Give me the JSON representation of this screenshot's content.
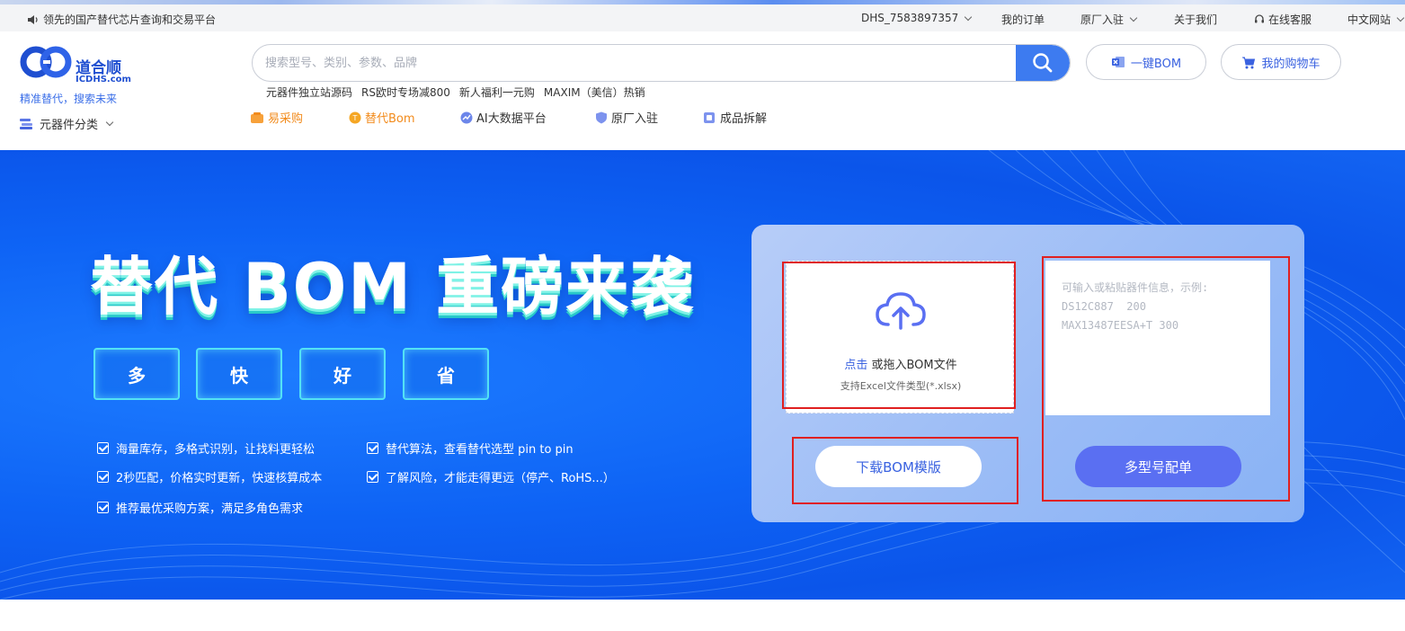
{
  "util_bar": {
    "notice": "领先的国产替代芯片查询和交易平台",
    "user": "DHS_7583897357",
    "orders": "我的订单",
    "factory": "原厂入驻",
    "about": "关于我们",
    "service": "在线客服",
    "language": "中文网站"
  },
  "header": {
    "logo_cn": "道合顺",
    "logo_en": "ICDHS.com",
    "slogan": "精准替代，搜索未来",
    "category": "元器件分类",
    "search_placeholder": "搜索型号、类别、参数、品牌",
    "bom_button": "一键BOM",
    "cart_button": "我的购物车",
    "hot_links": [
      "元器件独立站源码",
      "RS欧时专场减800",
      "新人福利一元购",
      "MAXIM（美信）热销"
    ],
    "nav": [
      "易采购",
      "替代Bom",
      "AI大数据平台",
      "原厂入驻",
      "成品拆解"
    ]
  },
  "banner": {
    "headline": "替代 BOM 重磅来袭",
    "badges": [
      "多",
      "快",
      "好",
      "省"
    ],
    "features": [
      "海量库存，多格式识别，让找料更轻松",
      "替代算法，查看替代选型 pin to pin",
      "2秒匹配，价格实时更新，快速核算成本",
      "了解风险，才能走得更远（停产、RoHS...）",
      "推荐最优采购方案，满足多角色需求"
    ]
  },
  "upload_panel": {
    "click_label": "点击",
    "drop_label": " 或拖入BOM文件",
    "support_label": "支持Excel文件类型(*.xlsx)",
    "download_button": "下载BOM模版",
    "textarea_placeholder": "可输入或粘贴器件信息，示例:\nDS12C887  200\nMAX13487EESA+T 300",
    "multi_button": "多型号配单"
  },
  "colors": {
    "accent": "#3d7bf0",
    "banner_blue": "#0e63f5",
    "highlight_red": "#e02020",
    "nav_orange": "#f28b1c",
    "multi_button": "#5a6ff2"
  },
  "icons": [
    "speaker-icon",
    "chevron-down-icon",
    "headset-icon",
    "logo-icon",
    "category-icon",
    "search-icon",
    "excel-icon",
    "cart-icon",
    "cloud-upload-icon",
    "checkbox-icon"
  ]
}
